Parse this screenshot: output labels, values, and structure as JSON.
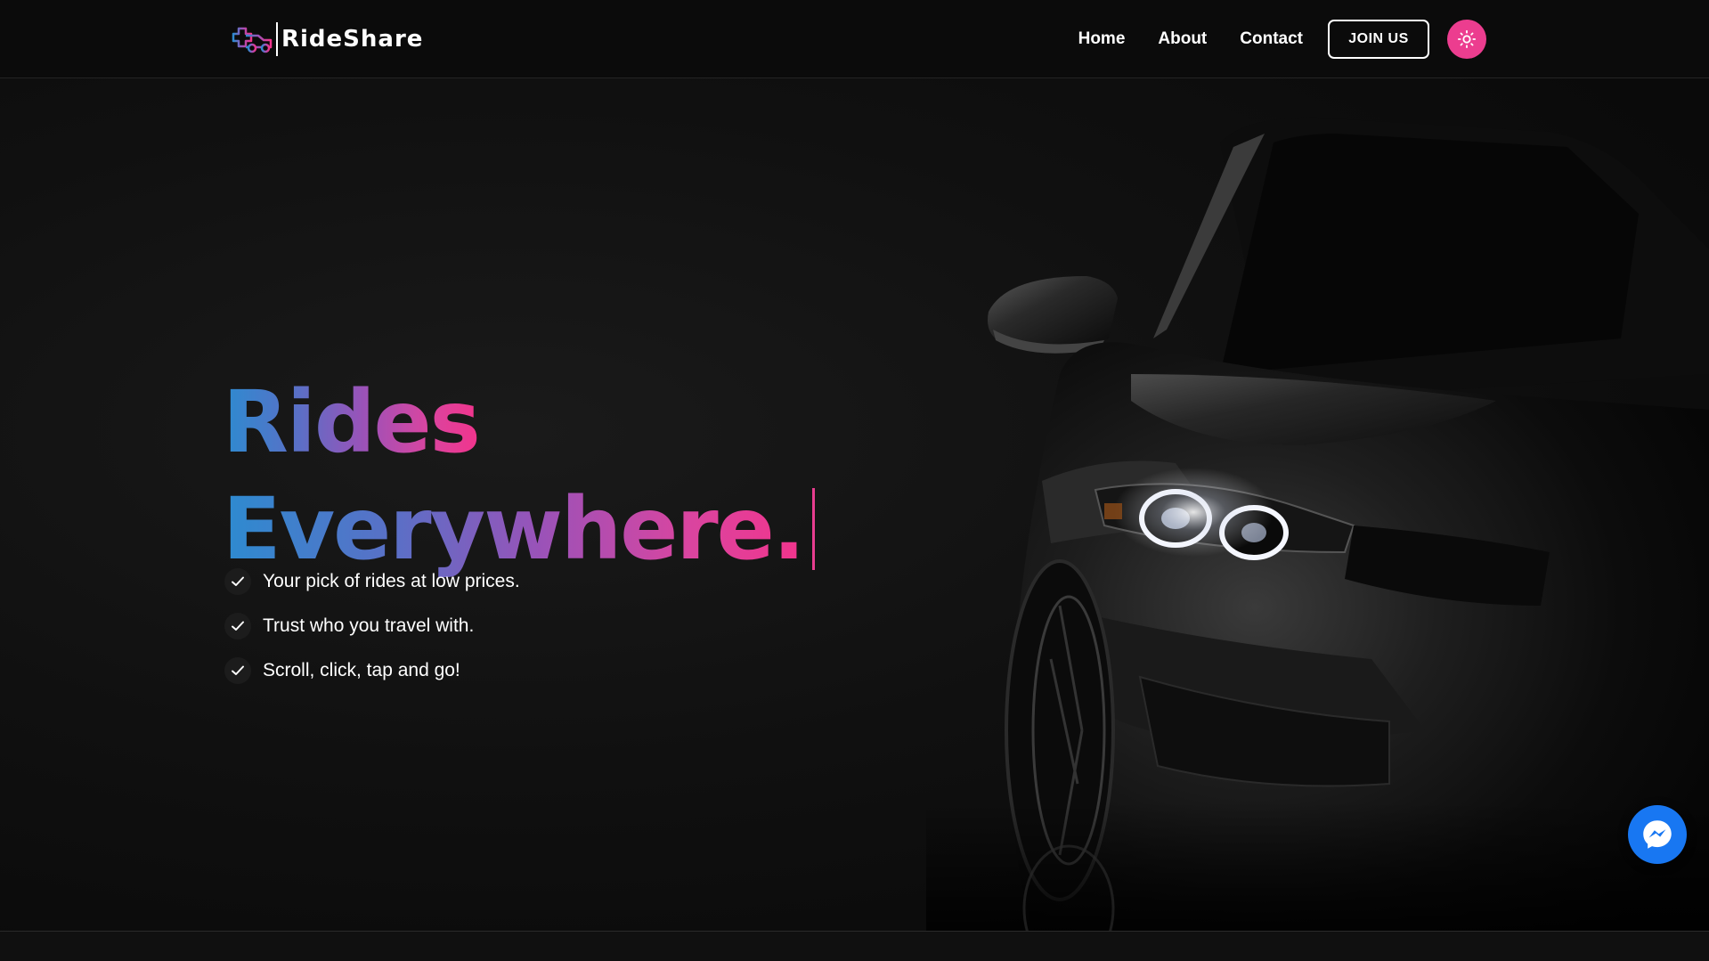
{
  "brand": {
    "name": "RideShare",
    "icon": "car-plus-logo-icon",
    "gradient": [
      "#2d8bd0",
      "#9b52b8",
      "#f2348c"
    ]
  },
  "nav": {
    "links": [
      "Home",
      "About",
      "Contact"
    ],
    "join_label": "JOIN US",
    "theme_toggle_icon": "sun-icon",
    "theme_toggle_color": "#ec3d8f"
  },
  "hero": {
    "title_line1": "Rides",
    "title_line2": "Everywhere.",
    "features": [
      "Your pick of rides at low prices.",
      "Trust who you travel with.",
      "Scroll, click, tap and go!"
    ],
    "feature_icon": "check-icon",
    "image": "black-sports-car-front-view"
  },
  "chat_widget": {
    "icon": "messenger-icon",
    "color": "#1877f2"
  }
}
